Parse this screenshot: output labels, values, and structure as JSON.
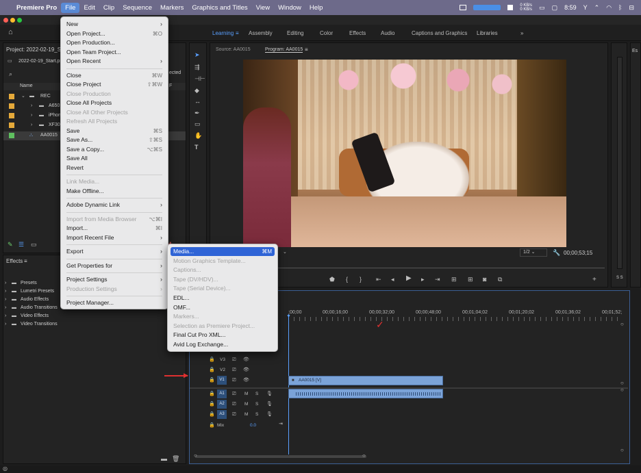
{
  "menubar": {
    "apple": "",
    "app": "Premiere Pro",
    "items": [
      "File",
      "Edit",
      "Clip",
      "Sequence",
      "Markers",
      "Graphics and Titles",
      "View",
      "Window",
      "Help"
    ],
    "net_up": "0 KB/s",
    "net_down": "0 KB/s",
    "clock": "8:59"
  },
  "workspaces": [
    "Learning",
    "Assembly",
    "Editing",
    "Color",
    "Effects",
    "Audio",
    "Captions and Graphics",
    "Libraries"
  ],
  "project": {
    "title": "Project: 2022-02-19_Start",
    "file": "2022-02-19_Start.pr",
    "selected_label": "ected",
    "col_name": "Name",
    "items": [
      {
        "name": "REC",
        "color": "#e5a93a"
      },
      {
        "name": "A650",
        "color": "#e5a93a"
      },
      {
        "name": "iPhon",
        "color": "#e5a93a"
      },
      {
        "name": "XF30",
        "color": "#e5a93a"
      },
      {
        "name": "AA0015",
        "color": "#5fbf5f"
      }
    ]
  },
  "effects": {
    "title": "Effects",
    "items": [
      "Presets",
      "Lumetri Presets",
      "Audio Effects",
      "Audio Transitions",
      "Video Effects",
      "Video Transitions"
    ]
  },
  "source": {
    "tab1": "Source: AA0015",
    "tab2": "Program: AA0015",
    "zoom": "1/2",
    "timecode": "00;00;53;15"
  },
  "file_menu": {
    "items": [
      {
        "label": "New",
        "sc": "",
        "sub": true,
        "dis": false
      },
      {
        "label": "Open Project...",
        "sc": "⌘O",
        "dis": false
      },
      {
        "label": "Open Production...",
        "sc": "",
        "dis": false
      },
      {
        "label": "Open Team Project...",
        "sc": "",
        "dis": false
      },
      {
        "label": "Open Recent",
        "sc": "",
        "sub": true,
        "dis": false
      },
      {
        "sep": true
      },
      {
        "label": "Close",
        "sc": "⌘W",
        "dis": false
      },
      {
        "label": "Close Project",
        "sc": "⇧⌘W",
        "dis": false
      },
      {
        "label": "Close Production",
        "sc": "",
        "dis": true
      },
      {
        "label": "Close All Projects",
        "sc": "",
        "dis": false
      },
      {
        "label": "Close All Other Projects",
        "sc": "",
        "dis": true
      },
      {
        "label": "Refresh All Projects",
        "sc": "",
        "dis": true
      },
      {
        "label": "Save",
        "sc": "⌘S",
        "dis": false
      },
      {
        "label": "Save As...",
        "sc": "⇧⌘S",
        "dis": false
      },
      {
        "label": "Save a Copy...",
        "sc": "⌥⌘S",
        "dis": false
      },
      {
        "label": "Save All",
        "sc": "",
        "dis": false
      },
      {
        "label": "Revert",
        "sc": "",
        "dis": false
      },
      {
        "sep": true
      },
      {
        "label": "Link Media...",
        "sc": "",
        "dis": true
      },
      {
        "label": "Make Offline...",
        "sc": "",
        "dis": false
      },
      {
        "sep": true
      },
      {
        "label": "Adobe Dynamic Link",
        "sc": "",
        "sub": true,
        "dis": false
      },
      {
        "sep": true
      },
      {
        "label": "Import from Media Browser",
        "sc": "⌥⌘I",
        "dis": true
      },
      {
        "label": "Import...",
        "sc": "⌘I",
        "dis": false
      },
      {
        "label": "Import Recent File",
        "sc": "",
        "sub": true,
        "dis": false
      },
      {
        "sep": true
      },
      {
        "label": "Export",
        "sc": "",
        "sub": true,
        "dis": false,
        "active": true
      },
      {
        "sep": true
      },
      {
        "label": "Get Properties for",
        "sc": "",
        "sub": true,
        "dis": false
      },
      {
        "sep": true
      },
      {
        "label": "Project Settings",
        "sc": "",
        "sub": true,
        "dis": false
      },
      {
        "label": "Production Settings",
        "sc": "",
        "sub": true,
        "dis": true
      },
      {
        "sep": true
      },
      {
        "label": "Project Manager...",
        "sc": "",
        "dis": false
      }
    ]
  },
  "export_menu": {
    "items": [
      {
        "label": "Media...",
        "sc": "⌘M",
        "hl": true
      },
      {
        "label": "Motion Graphics Template...",
        "dis": true
      },
      {
        "label": "Captions...",
        "dis": true
      },
      {
        "label": "Tape (DV/HDV)...",
        "dis": true
      },
      {
        "label": "Tape (Serial Device)...",
        "dis": true
      },
      {
        "label": "EDL..."
      },
      {
        "label": "OMF..."
      },
      {
        "label": "Markers...",
        "dis": true
      },
      {
        "label": "Selection as Premiere Project...",
        "dis": true
      },
      {
        "label": "Final Cut Pro XML..."
      },
      {
        "label": "Avid Log Exchange..."
      }
    ]
  },
  "timeline": {
    "timecodes": [
      ";00;00",
      "00;00;16;00",
      "00;00;32;00",
      "00;00;48;00",
      "00;01;04;02",
      "00;01;20;02",
      "00;01;36;02",
      "00;01;52;"
    ],
    "video_tracks": [
      "V3",
      "V2",
      "V1"
    ],
    "audio_tracks": [
      "A1",
      "A2",
      "A3"
    ],
    "clip": "AA0015 [V]",
    "mix_label": "Mix",
    "mix_value": "0.0"
  },
  "meter": {
    "label": "S S"
  },
  "right_panel": {
    "label": "Es"
  }
}
